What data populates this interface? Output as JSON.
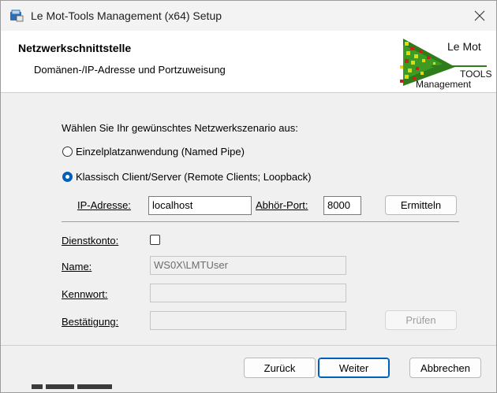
{
  "window": {
    "title": "Le Mot-Tools Management (x64) Setup",
    "app_icon": "installer-icon",
    "close_icon": "close-icon"
  },
  "header": {
    "title": "Netzwerkschnittstelle",
    "subtitle": "Domänen-/IP-Adresse und Portzuweisung",
    "logo": {
      "line1": "Le Mot",
      "line2": "TOOLS",
      "line3": "Management",
      "colors": [
        "#2e7d1a",
        "#e6d800",
        "#c8241c"
      ]
    }
  },
  "network": {
    "prompt": "Wählen Sie Ihr gewünschtes Netzwerkszenario aus:",
    "options": [
      {
        "label": "Einzelplatzanwendung (Named Pipe)",
        "checked": false
      },
      {
        "label": "Klassisch Client/Server (Remote Clients; Loopback)",
        "checked": true
      }
    ],
    "ip_label": "IP-Adresse:",
    "ip_value": "localhost",
    "port_label": "Abhör-Port:",
    "port_value": "8000",
    "detect_button": "Ermitteln"
  },
  "service_account": {
    "checkbox_label": "Dienstkonto:",
    "checked": false,
    "name_label": "Name:",
    "name_value": "WS0X\\LMTUser",
    "password_label": "Kennwort:",
    "password_value": "",
    "confirm_label": "Bestätigung:",
    "confirm_value": "",
    "check_button": "Prüfen"
  },
  "footer": {
    "back_button": "Zurück",
    "next_button": "Weiter",
    "cancel_button": "Abbrechen"
  }
}
